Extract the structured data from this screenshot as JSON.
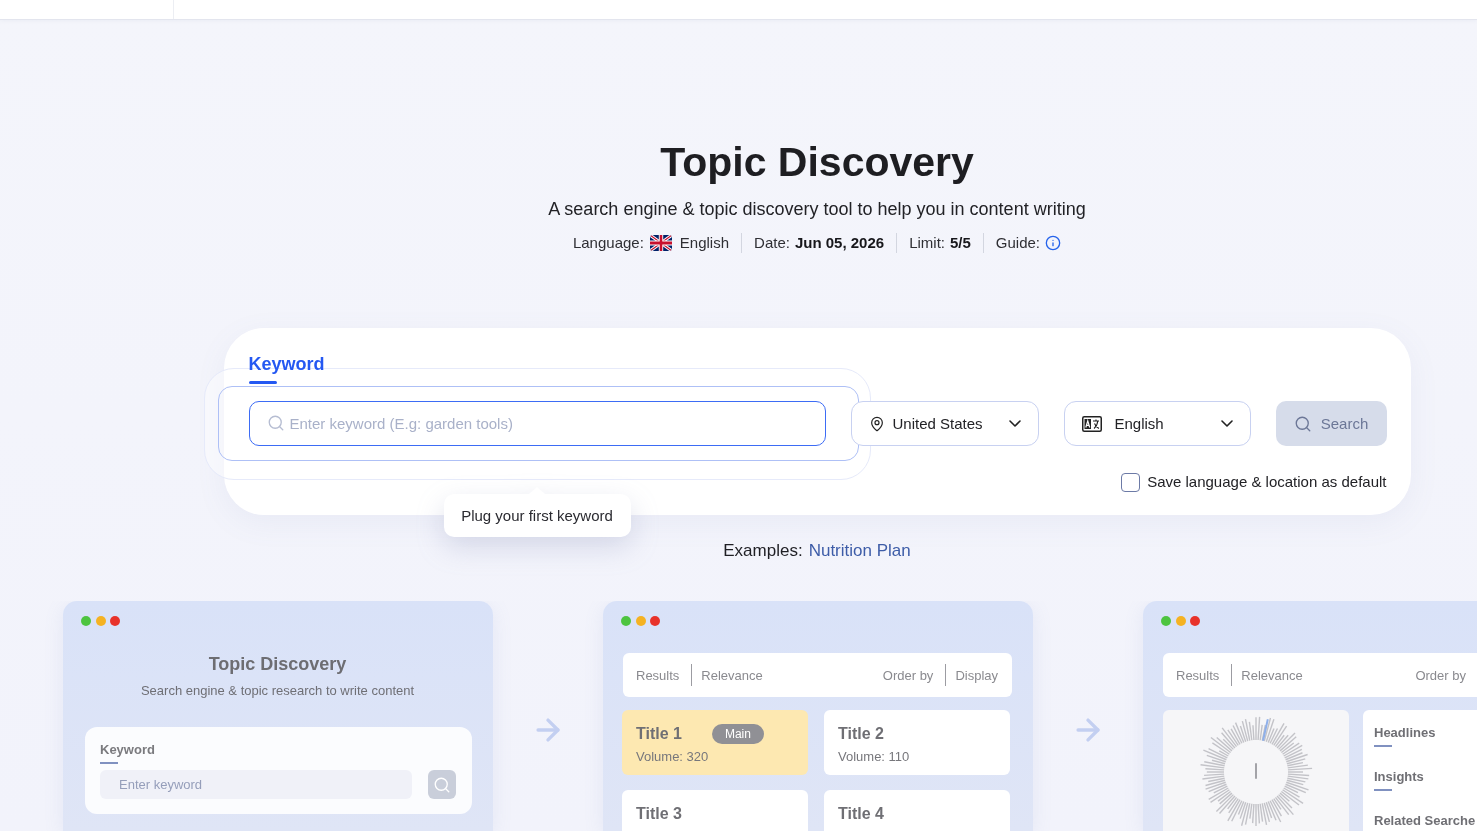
{
  "page": {
    "title": "Topic Discovery",
    "subtitle": "A search engine & topic discovery tool to help you in content writing"
  },
  "meta": [
    {
      "kind": "language",
      "label": "Language:",
      "value": "English"
    },
    {
      "kind": "date",
      "label": "Date:",
      "value": "Jun 05, 2026"
    },
    {
      "kind": "limit",
      "label": "Limit:",
      "value": "5/5"
    },
    {
      "kind": "guide",
      "label": "Guide:"
    }
  ],
  "search_panel": {
    "tabs": [
      {
        "label": "Keyword",
        "selected": true
      }
    ],
    "keyword_field": {
      "placeholder": "Enter keyword (E.g: garden tools)"
    },
    "location_select": {
      "value": "United States"
    },
    "language_select": {
      "value": "English"
    },
    "search_button": {
      "label": "Search",
      "disabled": true
    },
    "save_default": {
      "label": "Save language & location as default",
      "checked": false
    },
    "tooltip": {
      "text": "Plug your first keyword"
    }
  },
  "examples": {
    "label": "Examples:",
    "links": [
      "Nutrition Plan"
    ]
  },
  "previews": [
    {
      "kind": "search",
      "title": "Topic Discovery",
      "subtitle": "Search engine & topic research to write content",
      "field_label": "Keyword",
      "placeholder": "Enter keyword"
    },
    {
      "kind": "results",
      "toolbar_left": [
        "Results",
        "Relevance"
      ],
      "toolbar_right": [
        "Order by",
        "Display"
      ],
      "tiles": [
        {
          "title": "Title 1",
          "badge": "Main",
          "volume": "Volume: 320",
          "selected": true
        },
        {
          "title": "Title 2",
          "volume": "Volume: 110",
          "selected": false
        },
        {
          "title": "Title 3",
          "selected": false
        },
        {
          "title": "Title 4",
          "selected": false
        }
      ]
    },
    {
      "kind": "insights",
      "toolbar_left": [
        "Results",
        "Relevance"
      ],
      "toolbar_right": [
        "Order by"
      ],
      "sections": [
        "Headlines",
        "Insights",
        "Related Searche"
      ]
    }
  ]
}
